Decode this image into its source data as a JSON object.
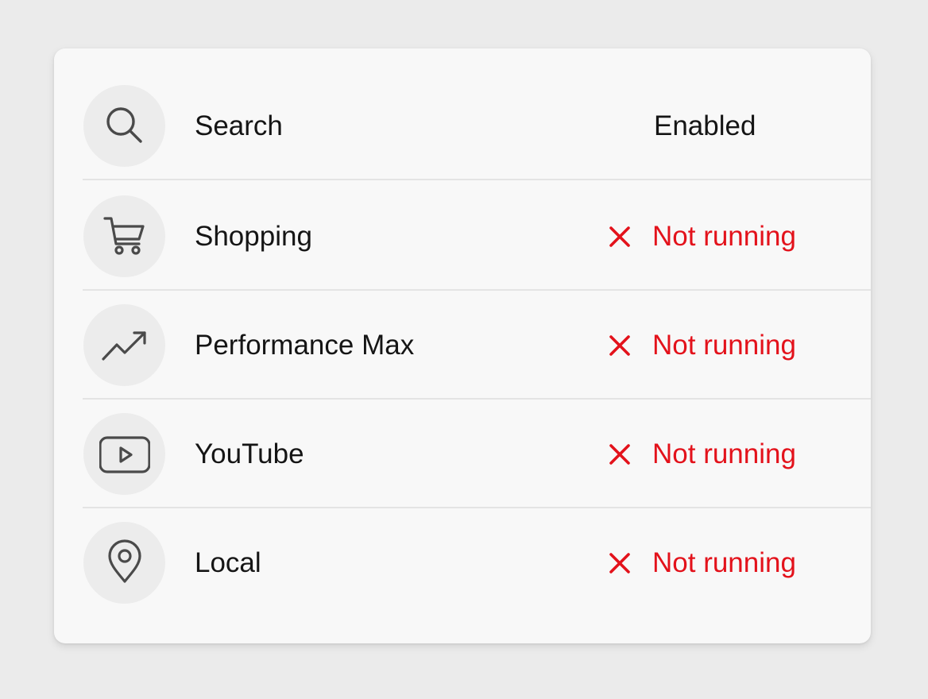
{
  "colors": {
    "page_background": "#ebebeb",
    "card_background": "#f8f8f8",
    "icon_circle": "#ececec",
    "icon_stroke": "#4a4a4a",
    "text": "#151515",
    "error_red": "#e3121b",
    "divider": "#e4e4e4"
  },
  "channels": [
    {
      "name": "Search",
      "icon": "search-icon",
      "status": "Enabled",
      "state": "enabled"
    },
    {
      "name": "Shopping",
      "icon": "cart-icon",
      "status": "Not running",
      "state": "off",
      "status_icon": "x-icon"
    },
    {
      "name": "Performance Max",
      "icon": "trending-up-icon",
      "status": "Not running",
      "state": "off",
      "status_icon": "x-icon"
    },
    {
      "name": "YouTube",
      "icon": "play-icon",
      "status": "Not running",
      "state": "off",
      "status_icon": "x-icon"
    },
    {
      "name": "Local",
      "icon": "map-pin-icon",
      "status": "Not running",
      "state": "off",
      "status_icon": "x-icon"
    }
  ]
}
